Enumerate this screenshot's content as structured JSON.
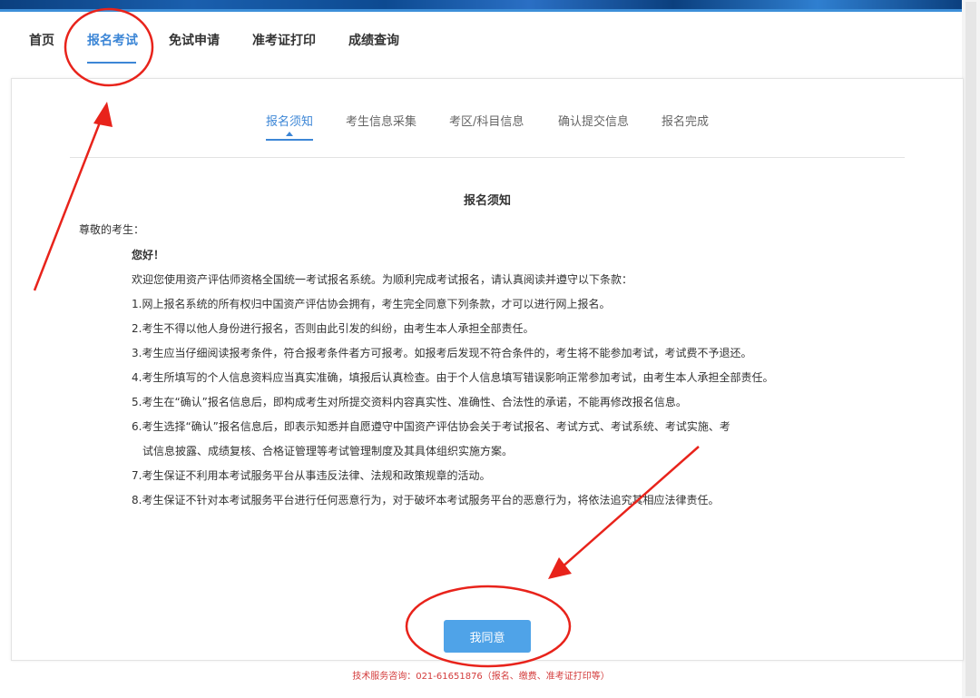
{
  "nav": {
    "items": [
      {
        "label": "首页"
      },
      {
        "label": "报名考试"
      },
      {
        "label": "免试申请"
      },
      {
        "label": "准考证打印"
      },
      {
        "label": "成绩查询"
      }
    ],
    "active_index": 1
  },
  "steps": {
    "items": [
      {
        "label": "报名须知"
      },
      {
        "label": "考生信息采集"
      },
      {
        "label": "考区/科目信息"
      },
      {
        "label": "确认提交信息"
      },
      {
        "label": "报名完成"
      }
    ],
    "active_index": 0
  },
  "notice": {
    "title": "报名须知",
    "greeting": "尊敬的考生：",
    "hello": "您好！",
    "intro": "欢迎您使用资产评估师资格全国统一考试报名系统。为顺利完成考试报名，请认真阅读并遵守以下条款：",
    "items": [
      "1.网上报名系统的所有权归中国资产评估协会拥有，考生完全同意下列条款，才可以进行网上报名。",
      "2.考生不得以他人身份进行报名，否则由此引发的纠纷，由考生本人承担全部责任。",
      "3.考生应当仔细阅读报考条件，符合报考条件者方可报考。如报考后发现不符合条件的，考生将不能参加考试，考试费不予退还。",
      "4.考生所填写的个人信息资料应当真实准确，填报后认真检查。由于个人信息填写错误影响正常参加考试，由考生本人承担全部责任。",
      "5.考生在“确认”报名信息后，即构成考生对所提交资料内容真实性、准确性、合法性的承诺，不能再修改报名信息。",
      "6.考生选择“确认”报名信息后，即表示知悉并自愿遵守中国资产评估协会关于考试报名、考试方式、考试系统、考试实施、考",
      "试信息披露、成绩复核、合格证管理等考试管理制度及其具体组织实施方案。",
      "7.考生保证不利用本考试服务平台从事违反法律、法规和政策规章的活动。",
      "8.考生保证不针对本考试服务平台进行任何恶意行为，对于破坏本考试服务平台的恶意行为，将依法追究其相应法律责任。"
    ]
  },
  "agree_button": {
    "label": "我同意"
  },
  "footer": {
    "text": "技术服务咨询：021-61651876（报名、缴费、准考证打印等）"
  },
  "colors": {
    "accent": "#3c86d6",
    "button": "#4fa3e8",
    "annotation": "#e8231b",
    "footer_text": "#d33b3b"
  }
}
